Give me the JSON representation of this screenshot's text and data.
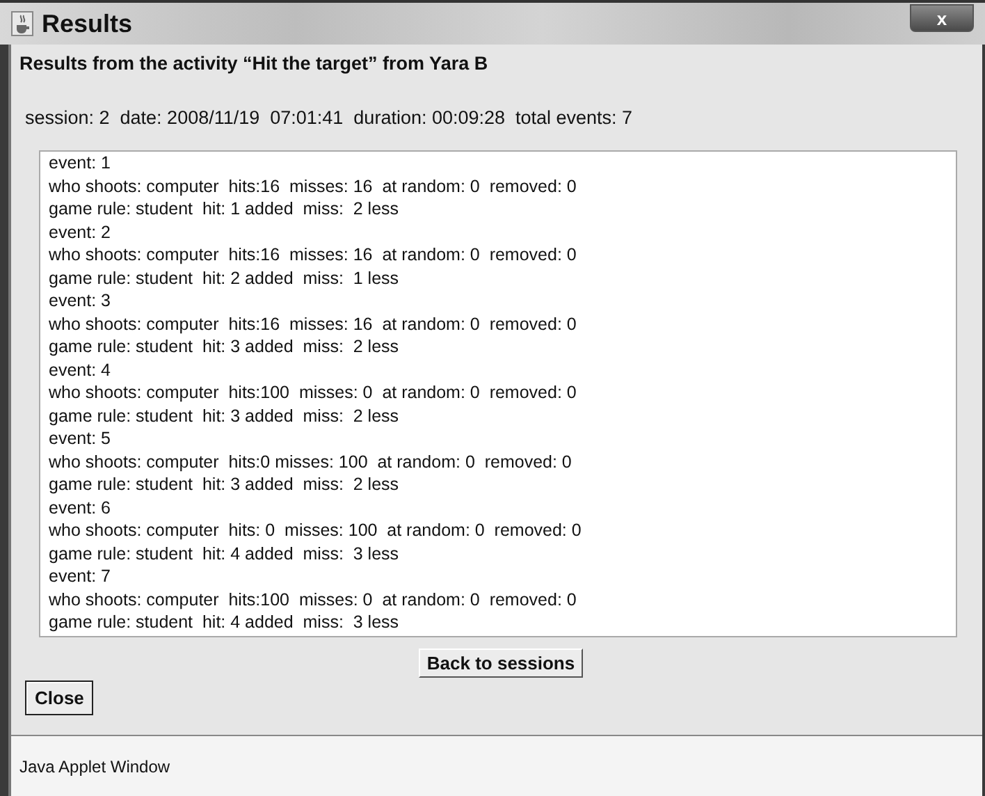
{
  "window": {
    "title": "Results",
    "close_label": "x"
  },
  "heading": "Results from the activity “Hit the target” from Yara B",
  "session_info": "session: 2  date: 2008/11/19  07:01:41  duration: 00:09:28  total events: 7",
  "log_lines": [
    "event: 1",
    "who shoots: computer  hits:16  misses: 16  at random: 0  removed: 0",
    "game rule: student  hit: 1 added  miss:  2 less",
    "event: 2",
    "who shoots: computer  hits:16  misses: 16  at random: 0  removed: 0",
    "game rule: student  hit: 2 added  miss:  1 less",
    "event: 3",
    "who shoots: computer  hits:16  misses: 16  at random: 0  removed: 0",
    "game rule: student  hit: 3 added  miss:  2 less",
    "event: 4",
    "who shoots: computer  hits:100  misses: 0  at random: 0  removed: 0",
    "game rule: student  hit: 3 added  miss:  2 less",
    "event: 5",
    "who shoots: computer  hits:0 misses: 100  at random: 0  removed: 0",
    "game rule: student  hit: 3 added  miss:  2 less",
    "event: 6",
    "who shoots: computer  hits: 0  misses: 100  at random: 0  removed: 0",
    "game rule: student  hit: 4 added  miss:  3 less",
    "event: 7",
    "who shoots: computer  hits:100  misses: 0  at random: 0  removed: 0",
    "game rule: student  hit: 4 added  miss:  3 less"
  ],
  "buttons": [
    "Back to sessions",
    "Close"
  ],
  "status_bar": "Java Applet Window"
}
